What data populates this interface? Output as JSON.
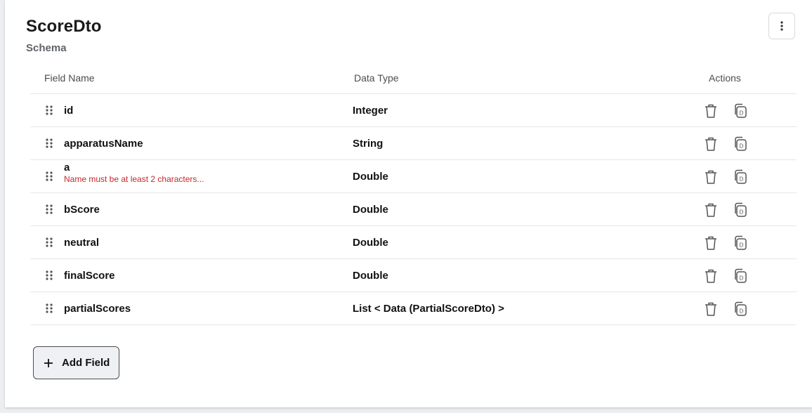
{
  "header": {
    "title": "ScoreDto",
    "subtitle": "Schema",
    "more_icon": "more-vertical-icon"
  },
  "table": {
    "columns": {
      "field_name": "Field Name",
      "data_type": "Data Type",
      "actions": "Actions"
    },
    "rows": [
      {
        "name": "id",
        "type": "Integer",
        "error": ""
      },
      {
        "name": "apparatusName",
        "type": "String",
        "error": ""
      },
      {
        "name": "a",
        "type": "Double",
        "error": "Name must be at least 2 characters..."
      },
      {
        "name": "bScore",
        "type": "Double",
        "error": ""
      },
      {
        "name": "neutral",
        "type": "Double",
        "error": ""
      },
      {
        "name": "finalScore",
        "type": "Double",
        "error": ""
      },
      {
        "name": "partialScores",
        "type": "List < Data (PartialScoreDto) >",
        "error": ""
      }
    ],
    "row_icons": {
      "drag": "drag-handle-icon",
      "delete": "trash-icon",
      "duplicate": "duplicate-icon"
    }
  },
  "footer": {
    "add_field_label": "Add Field"
  },
  "colors": {
    "error": "#c62828",
    "border": "#e4e6e9",
    "muted": "#5f6368"
  }
}
